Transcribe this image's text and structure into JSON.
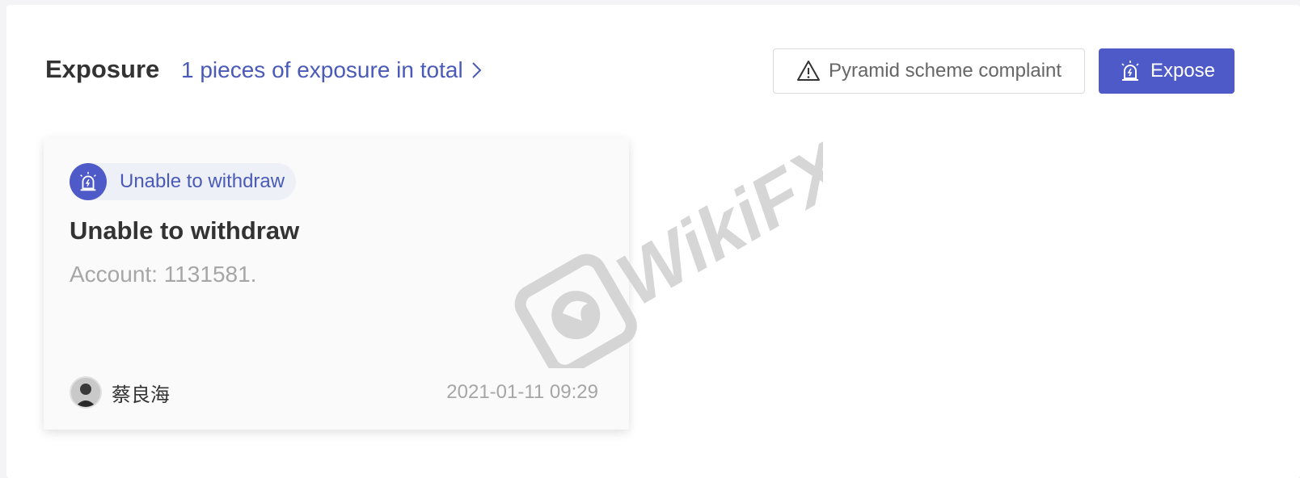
{
  "header": {
    "title": "Exposure",
    "count_link": "1 pieces of exposure in total",
    "complaint_button": "Pyramid scheme complaint",
    "expose_button": "Expose"
  },
  "card": {
    "tag": "Unable to withdraw",
    "title": "Unable to withdraw",
    "description": "Account: 1131581.",
    "author": "蔡良海",
    "date": "2021-01-11 09:29"
  },
  "watermark": "WikiFX",
  "colors": {
    "accent": "#4e5ac8",
    "link": "#4a5ab8",
    "muted": "#a6a6a6"
  },
  "icons": [
    "chevron-right-icon",
    "warning-icon",
    "alarm-light-icon",
    "avatar"
  ]
}
